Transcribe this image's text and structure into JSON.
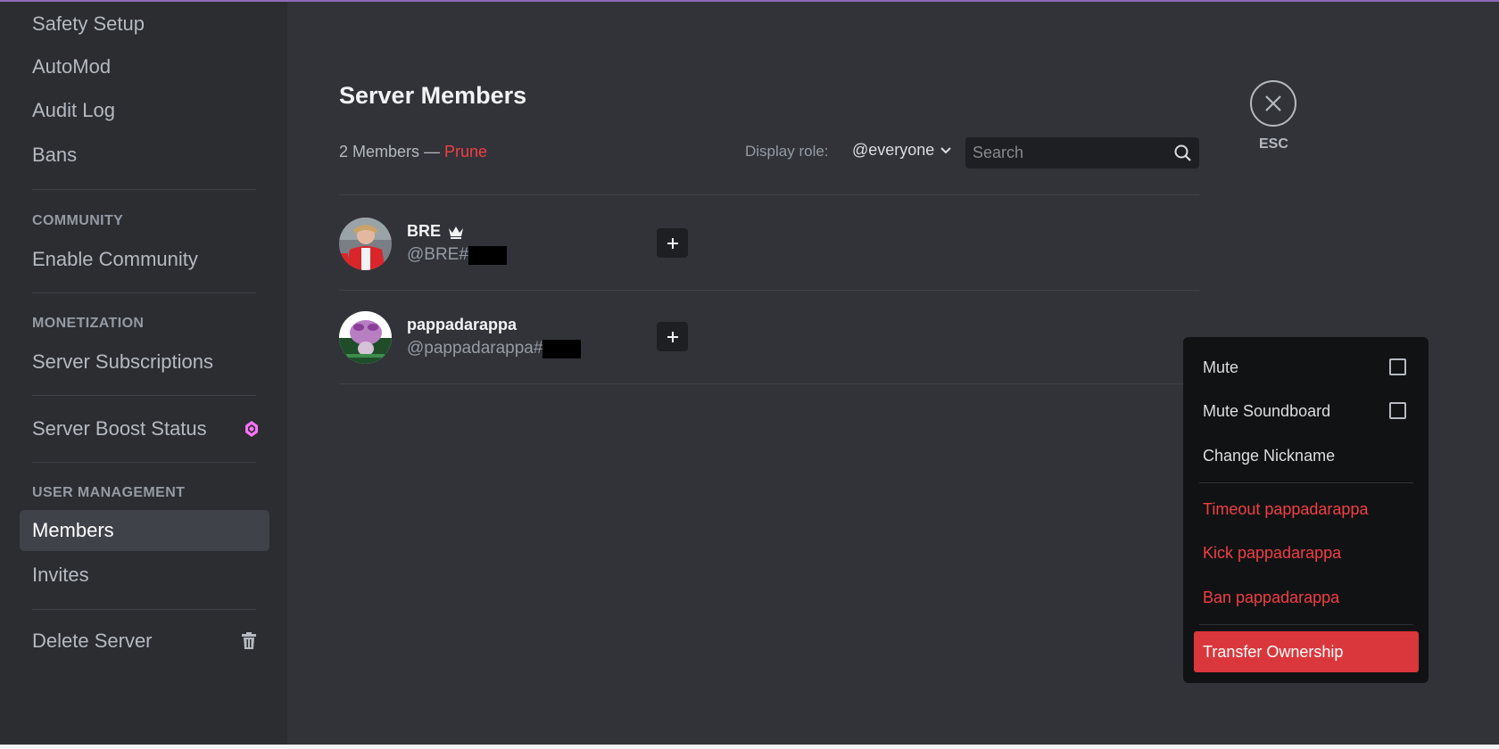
{
  "sidebar": {
    "items_top": [
      "Safety Setup",
      "AutoMod",
      "Audit Log",
      "Bans"
    ],
    "community_header": "COMMUNITY",
    "enable_community": "Enable Community",
    "monetization_header": "MONETIZATION",
    "server_subscriptions": "Server Subscriptions",
    "server_boost_status": "Server Boost Status",
    "user_management_header": "USER MANAGEMENT",
    "members": "Members",
    "invites": "Invites",
    "delete_server": "Delete Server"
  },
  "main": {
    "title": "Server Members",
    "member_count": "2 Members — ",
    "prune": "Prune",
    "display_role_label": "Display role:",
    "display_role_value": "@everyone",
    "search_placeholder": "Search",
    "esc_label": "ESC"
  },
  "members": [
    {
      "name": "BRE",
      "tag": "@BRE#",
      "owner": true
    },
    {
      "name": "pappadarappa",
      "tag": "@pappadarappa#",
      "owner": false
    }
  ],
  "context_menu": {
    "mute": "Mute",
    "mute_soundboard": "Mute Soundboard",
    "change_nickname": "Change Nickname",
    "timeout": "Timeout pappadarappa",
    "kick": "Kick pappadarappa",
    "ban": "Ban pappadarappa",
    "transfer": "Transfer Ownership"
  },
  "colors": {
    "accent_danger": "#da373c",
    "danger_text": "#f23f42",
    "boost_pink": "#ff73fa",
    "background": "#313338",
    "sidebar": "#2b2d31"
  }
}
